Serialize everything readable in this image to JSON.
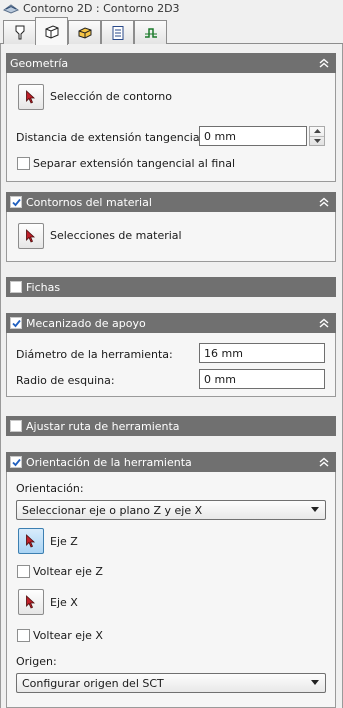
{
  "window": {
    "title": "Contorno 2D : Contorno 2D3"
  },
  "tabs": [
    {
      "icon": "tool-icon",
      "active": false
    },
    {
      "icon": "stock-icon",
      "active": true
    },
    {
      "icon": "setup-icon",
      "active": false
    },
    {
      "icon": "sheet-icon",
      "active": false
    },
    {
      "icon": "linking-icon",
      "active": false
    }
  ],
  "geometria": {
    "title": "Geometría",
    "seleccion_btn_label": "Selección de contorno",
    "distancia_label": "Distancia de extensión tangencial:",
    "distancia_value": "0 mm",
    "separar_label": "Separar extensión tangencial al final",
    "separar_checked": false
  },
  "contornos": {
    "title": "Contornos del material",
    "checked": true,
    "selecciones_label": "Selecciones de material"
  },
  "fichas": {
    "title": "Fichas",
    "checked": false
  },
  "mecanizado": {
    "title": "Mecanizado de apoyo",
    "checked": true,
    "diametro_label": "Diámetro de la herramienta:",
    "diametro_value": "16 mm",
    "radio_label": "Radio de esquina:",
    "radio_value": "0 mm"
  },
  "ajustar": {
    "title": "Ajustar ruta de herramienta",
    "checked": false
  },
  "orientacion": {
    "title": "Orientación de la herramienta",
    "checked": true,
    "orient_label": "Orientación:",
    "orient_select": "Seleccionar eje o plano Z y eje X",
    "eje_z_label": "Eje Z",
    "voltear_z_label": "Voltear eje Z",
    "eje_x_label": "Eje X",
    "voltear_x_label": "Voltear eje X",
    "origen_label": "Origen:",
    "origen_select": "Configurar origen del SCT"
  },
  "colors": {
    "header_bg": "#707070",
    "panel_bg": "#f6f6f6",
    "check_blue": "#2060c0",
    "pick_arrow": "#c0202a"
  }
}
